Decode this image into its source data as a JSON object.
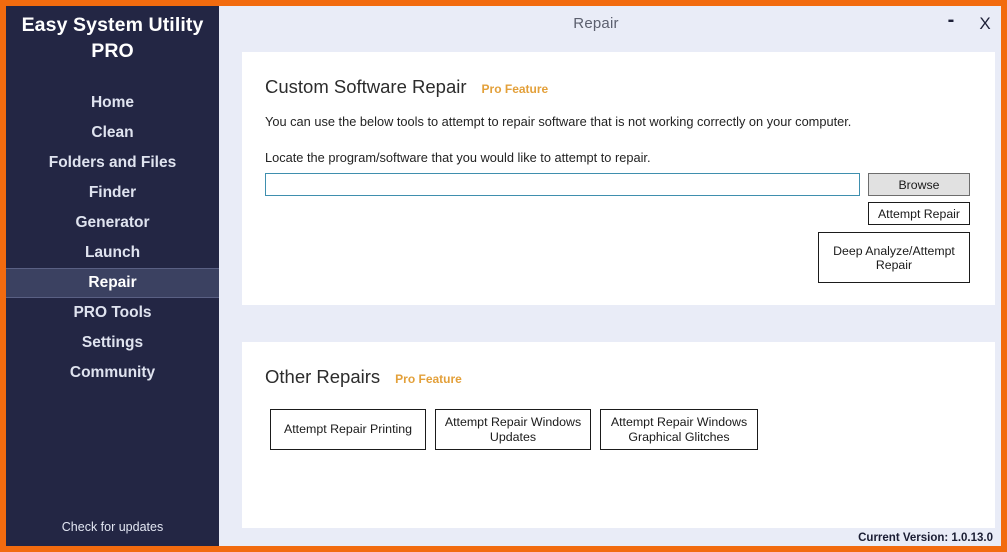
{
  "window": {
    "title": "Repair",
    "minimize_label": "-",
    "close_label": "X"
  },
  "sidebar": {
    "brand": "Easy System Utility PRO",
    "items": [
      {
        "label": "Home"
      },
      {
        "label": "Clean"
      },
      {
        "label": "Folders and Files"
      },
      {
        "label": "Finder"
      },
      {
        "label": "Generator"
      },
      {
        "label": "Launch"
      },
      {
        "label": "Repair"
      },
      {
        "label": "PRO Tools"
      },
      {
        "label": "Settings"
      },
      {
        "label": "Community"
      }
    ],
    "selected": "Repair",
    "footer": "Check for updates"
  },
  "custom_repair": {
    "title": "Custom Software Repair",
    "pro_badge": "Pro Feature",
    "description": "You can use the below tools to attempt to repair software that is not working correctly on your computer.",
    "locate_label": "Locate the program/software that you would like to attempt to repair.",
    "path_value": "",
    "path_placeholder": "",
    "browse_label": "Browse",
    "attempt_repair_label": "Attempt Repair",
    "deep_analyze_label": "Deep Analyze/Attempt Repair"
  },
  "other_repairs": {
    "title": "Other Repairs",
    "pro_badge": "Pro Feature",
    "buttons": [
      {
        "label": "Attempt Repair Printing"
      },
      {
        "label": "Attempt Repair Windows Updates"
      },
      {
        "label": "Attempt Repair Windows Graphical Glitches"
      }
    ]
  },
  "status": {
    "version": "Current Version: 1.0.13.0"
  },
  "colors": {
    "accent_orange": "#f26b0f",
    "sidebar_navy": "#232644",
    "sidebar_selected": "#3b4161",
    "content_bg": "#e9ecf7",
    "pro_gold": "#e3a03a",
    "input_border": "#3f8fae"
  }
}
